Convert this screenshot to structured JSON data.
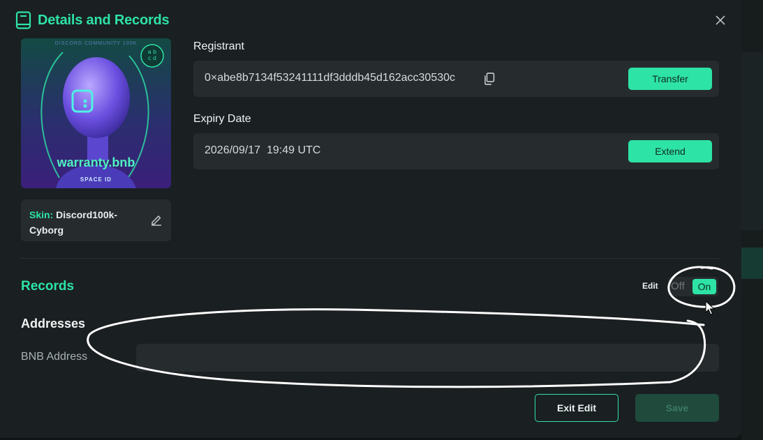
{
  "modal": {
    "title": "Details and Records",
    "icon": "book-icon",
    "close_icon": "close-icon"
  },
  "nft": {
    "name": "warranty.bnb",
    "brand": "SPACE ID",
    "top_text": "DISCORD COMMUNITY 100K",
    "badge": "abcd"
  },
  "skin": {
    "key": "Skin:",
    "value": "Discord100k-Cyborg",
    "edit_icon": "pencil-icon"
  },
  "registrant": {
    "label": "Registrant",
    "value": "0×abe8b7134f53241111df3dddb45d162acc30530c",
    "copy_icon": "copy-icon",
    "button": "Transfer"
  },
  "expiry": {
    "label": "Expiry Date",
    "value": "2026/09/17  19:49 UTC",
    "button": "Extend"
  },
  "records": {
    "title": "Records",
    "edit_label": "Edit",
    "toggle_off": "Off",
    "toggle_on": "On",
    "toggle_state": "on"
  },
  "addresses": {
    "title": "Addresses",
    "bnb_label": "BNB Address",
    "bnb_value": ""
  },
  "footer": {
    "exit_label": "Exit Edit",
    "save_label": "Save"
  },
  "colors": {
    "accent": "#2de3a5",
    "background": "#1a1f21",
    "field": "#262c2e"
  }
}
